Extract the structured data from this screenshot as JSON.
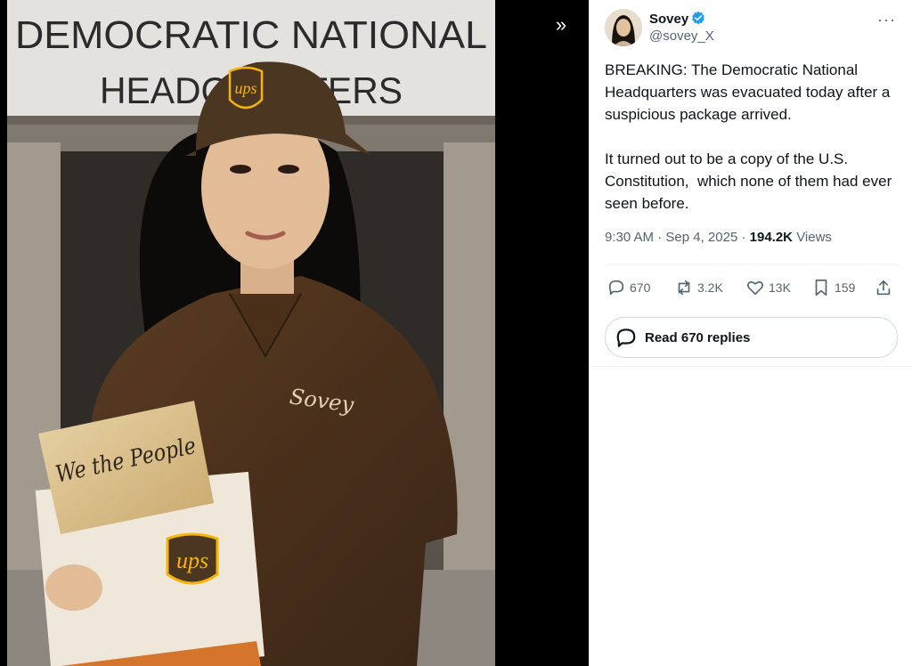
{
  "media": {
    "building_sign_line1": "DEMOCRATIC NATIONAL",
    "building_sign_line2": "HEADQUARTERS",
    "cap_logo": "ups",
    "shirt_name": "Sovey",
    "document_text": "We the People",
    "envelope_logo": "ups"
  },
  "post": {
    "display_name": "Sovey",
    "handle": "@sovey_X",
    "text": "BREAKING: The Democratic National Headquarters was evacuated today after a suspicious package arrived.\n\nIt turned out to be a copy of the U.S. Constitution,  which none of them had ever seen before.",
    "time": "9:30 AM",
    "date": "Sep 4, 2025",
    "views_count": "194.2K",
    "views_label": "Views"
  },
  "actions": {
    "replies": "670",
    "reposts": "3.2K",
    "likes": "13K",
    "bookmarks": "159"
  },
  "read_replies_label": "Read 670 replies",
  "colors": {
    "verified": "#1d9bf0",
    "ups_brown": "#4b3621",
    "ups_gold": "#f7b500"
  }
}
